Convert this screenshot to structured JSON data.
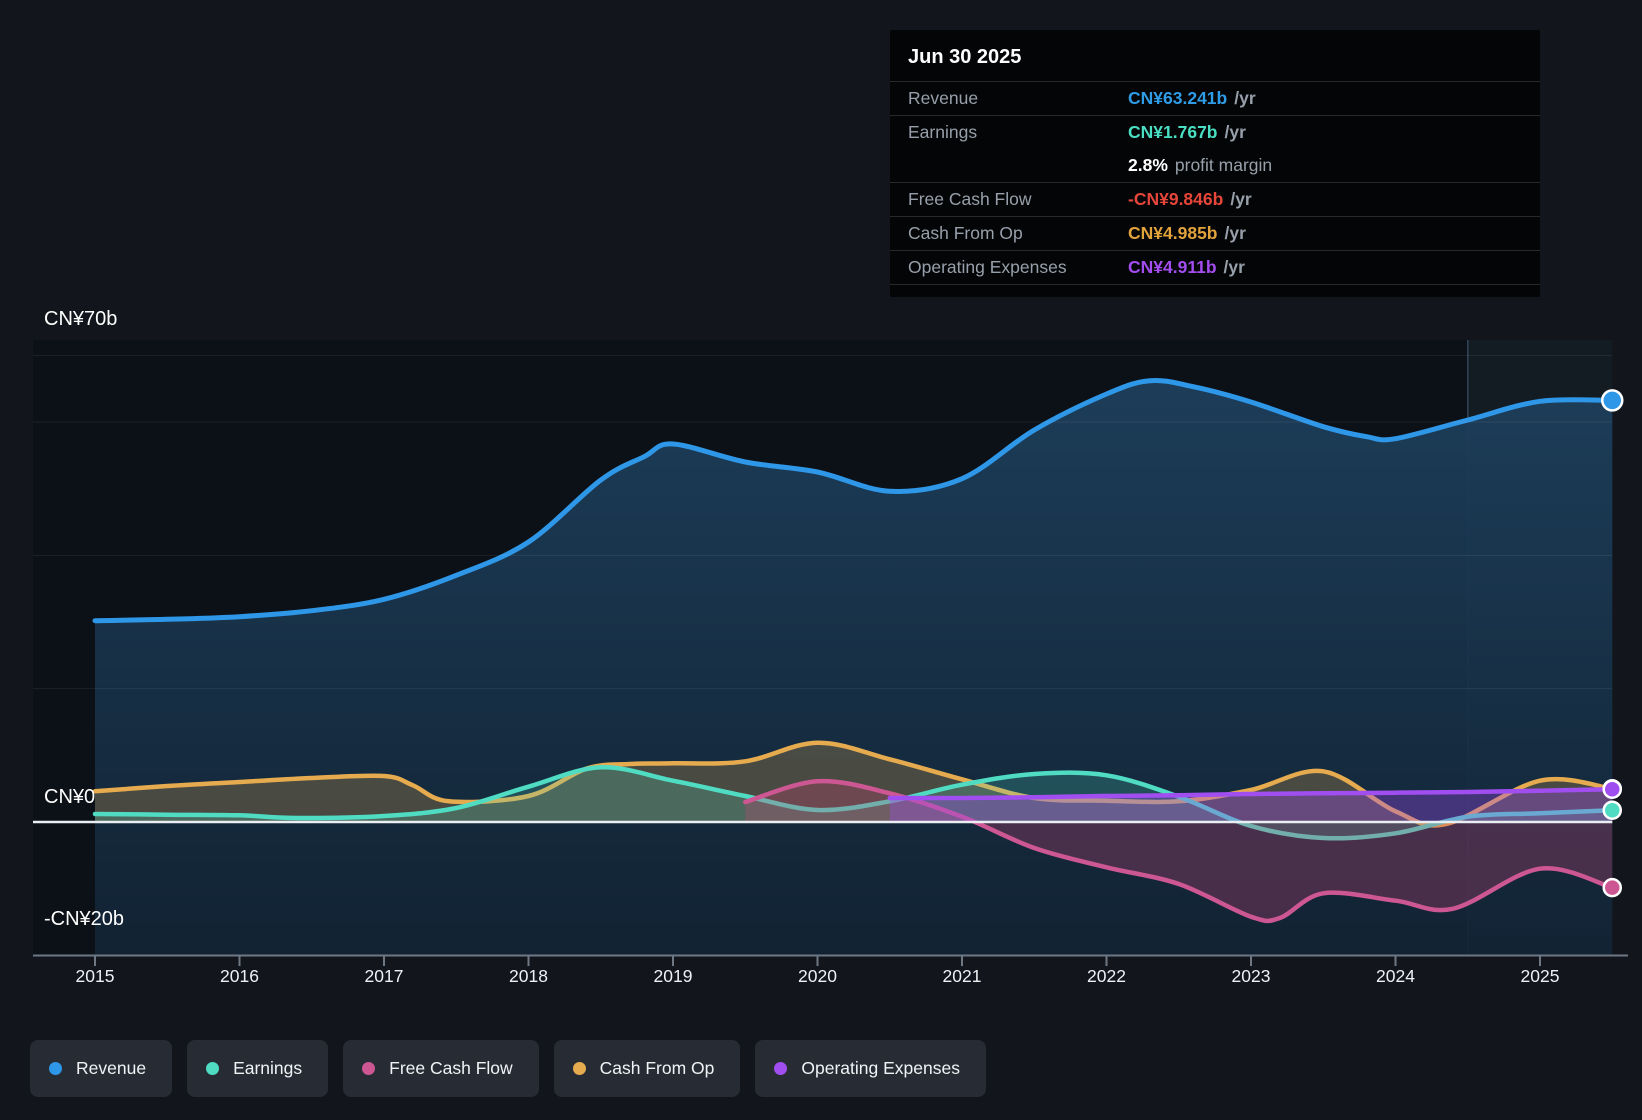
{
  "tooltip": {
    "date": "Jun 30 2025",
    "rows": [
      {
        "type": "row",
        "label": "Revenue",
        "value": "CN¥63.241b",
        "suffix": "/yr",
        "color": "#2f9ce8"
      },
      {
        "type": "row",
        "label": "Earnings",
        "value": "CN¥1.767b",
        "suffix": "/yr",
        "color": "#49dfc2"
      },
      {
        "type": "sub",
        "label": "",
        "value": "2.8%",
        "suffix": "profit margin",
        "color": "#ffffff"
      },
      {
        "type": "row",
        "label": "Free Cash Flow",
        "value": "-CN¥9.846b",
        "suffix": "/yr",
        "color": "#e64539"
      },
      {
        "type": "row",
        "label": "Cash From Op",
        "value": "CN¥4.985b",
        "suffix": "/yr",
        "color": "#e2a33c"
      },
      {
        "type": "row",
        "label": "Operating Expenses",
        "value": "CN¥4.911b",
        "suffix": "/yr",
        "color": "#a44df0"
      }
    ]
  },
  "y_axis": {
    "labels": [
      {
        "text": "CN¥70b",
        "value": 70
      },
      {
        "text": "CN¥0",
        "value": 0
      },
      {
        "text": "-CN¥20b",
        "value": -20
      }
    ]
  },
  "legend": {
    "items": [
      {
        "label": "Revenue",
        "color": "#2f97e8"
      },
      {
        "label": "Earnings",
        "color": "#4fdcc3"
      },
      {
        "label": "Free Cash Flow",
        "color": "#cd5793"
      },
      {
        "label": "Cash From Op",
        "color": "#e6ab4f"
      },
      {
        "label": "Operating Expenses",
        "color": "#a14ef0"
      }
    ]
  },
  "chart_data": {
    "type": "area",
    "title": "Company financial history, CN¥ billions per year",
    "unit": "CN¥ billions /yr",
    "x_ticks": [
      2015,
      2016,
      2017,
      2018,
      2019,
      2020,
      2021,
      2022,
      2023,
      2024,
      2025
    ],
    "xlim": [
      2014.55,
      2025.5
    ],
    "ylim": [
      -20,
      70
    ],
    "gridline_values": [
      70,
      60,
      40,
      20
    ],
    "zero_line": true,
    "axis_value": -20,
    "highlight_start": 2024.5,
    "highlight_end": 2025.5,
    "series": [
      {
        "name": "Revenue",
        "color": "#2f97e8",
        "baseline": "bottom",
        "fill": "gradient-blue",
        "marker_radius": 10,
        "points": [
          [
            2015,
            30.2
          ],
          [
            2015.5,
            30.4
          ],
          [
            2016,
            30.8
          ],
          [
            2016.5,
            31.7
          ],
          [
            2017,
            33.4
          ],
          [
            2017.5,
            37.0
          ],
          [
            2018,
            42.0
          ],
          [
            2018.5,
            51.3
          ],
          [
            2018.8,
            54.8
          ],
          [
            2019,
            56.7
          ],
          [
            2019.5,
            54.0
          ],
          [
            2020,
            52.5
          ],
          [
            2020.5,
            49.6
          ],
          [
            2021,
            51.5
          ],
          [
            2021.5,
            58.8
          ],
          [
            2022,
            64.2
          ],
          [
            2022.3,
            66.2
          ],
          [
            2022.6,
            65.3
          ],
          [
            2023,
            63.0
          ],
          [
            2023.5,
            59.3
          ],
          [
            2023.8,
            57.8
          ],
          [
            2024,
            57.5
          ],
          [
            2024.5,
            60.3
          ],
          [
            2025,
            63.1
          ],
          [
            2025.5,
            63.241
          ]
        ]
      },
      {
        "name": "Cash From Op",
        "color": "#e6ab4f",
        "baseline": "zero",
        "fill": "rgba(230,172,80,0.25)",
        "marker_radius": 8.5,
        "points": [
          [
            2015,
            4.6
          ],
          [
            2015.5,
            5.4
          ],
          [
            2016,
            6.0
          ],
          [
            2016.5,
            6.6
          ],
          [
            2017,
            6.9
          ],
          [
            2017.2,
            5.5
          ],
          [
            2017.45,
            3.1
          ],
          [
            2018,
            3.9
          ],
          [
            2018.4,
            8.0
          ],
          [
            2018.7,
            8.7
          ],
          [
            2019,
            8.8
          ],
          [
            2019.5,
            9.1
          ],
          [
            2020,
            11.9
          ],
          [
            2020.5,
            9.4
          ],
          [
            2021,
            6.4
          ],
          [
            2021.5,
            3.6
          ],
          [
            2022,
            3.2
          ],
          [
            2022.5,
            3.1
          ],
          [
            2023,
            4.8
          ],
          [
            2023.5,
            7.6
          ],
          [
            2024,
            1.6
          ],
          [
            2024.35,
            -0.3
          ],
          [
            2025,
            6.2
          ],
          [
            2025.5,
            4.985
          ]
        ]
      },
      {
        "name": "Earnings",
        "color": "#4fdcc3",
        "baseline": "zero",
        "fill": "rgba(80,220,190,0.22)",
        "marker_radius": 8.5,
        "points": [
          [
            2015,
            1.2
          ],
          [
            2015.5,
            1.1
          ],
          [
            2016,
            1.0
          ],
          [
            2016.4,
            0.6
          ],
          [
            2017,
            0.9
          ],
          [
            2017.5,
            2.1
          ],
          [
            2018,
            5.3
          ],
          [
            2018.5,
            8.2
          ],
          [
            2019,
            6.2
          ],
          [
            2019.5,
            3.9
          ],
          [
            2020,
            1.8
          ],
          [
            2020.5,
            3.1
          ],
          [
            2021,
            5.6
          ],
          [
            2021.5,
            7.2
          ],
          [
            2022,
            7.0
          ],
          [
            2022.5,
            3.8
          ],
          [
            2023,
            -0.6
          ],
          [
            2023.5,
            -2.4
          ],
          [
            2024,
            -1.7
          ],
          [
            2024.5,
            0.8
          ],
          [
            2025,
            1.3
          ],
          [
            2025.5,
            1.767
          ]
        ]
      },
      {
        "name": "Free Cash Flow",
        "color": "#cd5793",
        "baseline": "zero",
        "fill": "rgba(195,70,115,0.30)",
        "marker_radius": 8.5,
        "points": [
          [
            2019.5,
            3.0
          ],
          [
            2020,
            6.1
          ],
          [
            2020.5,
            4.3
          ],
          [
            2021,
            0.8
          ],
          [
            2021.5,
            -3.9
          ],
          [
            2022,
            -6.8
          ],
          [
            2022.5,
            -9.3
          ],
          [
            2023,
            -14.2
          ],
          [
            2023.2,
            -14.4
          ],
          [
            2023.5,
            -10.7
          ],
          [
            2024,
            -11.8
          ],
          [
            2024.4,
            -13.0
          ],
          [
            2025,
            -7.0
          ],
          [
            2025.5,
            -9.846
          ]
        ]
      },
      {
        "name": "Operating Expenses",
        "color": "#a14ef0",
        "baseline": "zero",
        "fill": "rgba(158,74,238,0.35)",
        "marker_radius": 8.5,
        "points": [
          [
            2020.5,
            3.6
          ],
          [
            2021,
            3.6
          ],
          [
            2021.5,
            3.7
          ],
          [
            2022,
            3.9
          ],
          [
            2022.5,
            4.0
          ],
          [
            2023,
            4.2
          ],
          [
            2023.5,
            4.3
          ],
          [
            2024,
            4.4
          ],
          [
            2024.5,
            4.5
          ],
          [
            2025,
            4.7
          ],
          [
            2025.5,
            4.911
          ]
        ]
      }
    ]
  }
}
